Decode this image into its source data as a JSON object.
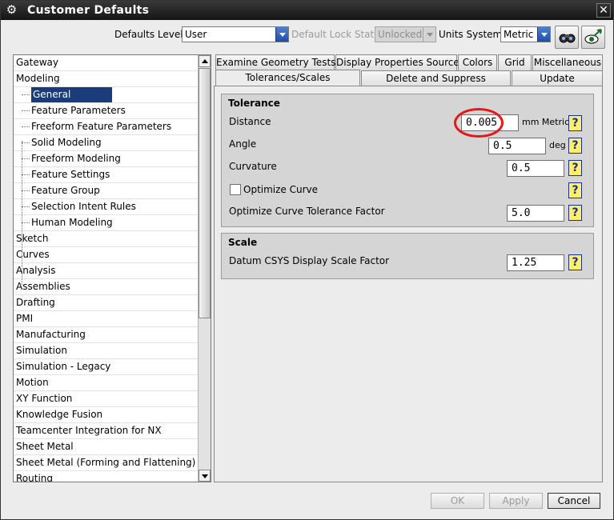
{
  "window": {
    "title": "Customer Defaults"
  },
  "toolbar": {
    "defaults_level_label": "Defaults Level",
    "defaults_level_value": "User",
    "lock_state_label": "Default Lock State",
    "lock_state_value": "Unlocked",
    "units_system_label": "Units System",
    "units_system_value": "Metric"
  },
  "tree": {
    "items": [
      {
        "label": "Gateway",
        "level": 0
      },
      {
        "label": "Modeling",
        "level": 0
      },
      {
        "label": "General",
        "level": 1,
        "selected": true
      },
      {
        "label": "Feature Parameters",
        "level": 1
      },
      {
        "label": "Freeform Feature Parameters",
        "level": 1
      },
      {
        "label": "Solid Modeling",
        "level": 1
      },
      {
        "label": "Freeform Modeling",
        "level": 1
      },
      {
        "label": "Feature Settings",
        "level": 1
      },
      {
        "label": "Feature Group",
        "level": 1
      },
      {
        "label": "Selection Intent Rules",
        "level": 1
      },
      {
        "label": "Human Modeling",
        "level": 1
      },
      {
        "label": "Sketch",
        "level": 0
      },
      {
        "label": "Curves",
        "level": 0
      },
      {
        "label": "Analysis",
        "level": 0
      },
      {
        "label": "Assemblies",
        "level": 0
      },
      {
        "label": "Drafting",
        "level": 0
      },
      {
        "label": "PMI",
        "level": 0
      },
      {
        "label": "Manufacturing",
        "level": 0
      },
      {
        "label": "Simulation",
        "level": 0
      },
      {
        "label": "Simulation - Legacy",
        "level": 0
      },
      {
        "label": "Motion",
        "level": 0
      },
      {
        "label": "XY Function",
        "level": 0
      },
      {
        "label": "Knowledge Fusion",
        "level": 0
      },
      {
        "label": "Teamcenter Integration for NX",
        "level": 0
      },
      {
        "label": "Sheet Metal",
        "level": 0
      },
      {
        "label": "Sheet Metal (Forming and Flattening)",
        "level": 0
      },
      {
        "label": "Routing",
        "level": 0
      }
    ]
  },
  "tabs": {
    "row1": [
      "Examine Geometry Tests",
      "Display Properties Source",
      "Colors",
      "Grid",
      "Miscellaneous"
    ],
    "row2": [
      "Tolerances/Scales",
      "Delete and Suppress",
      "Update"
    ],
    "active": "Tolerances/Scales"
  },
  "tolerance": {
    "header": "Tolerance",
    "distance_label": "Distance",
    "distance_value": "0.005",
    "distance_unit": "mm Metric",
    "angle_label": "Angle",
    "angle_value": "0.5",
    "angle_unit": "deg",
    "curvature_label": "Curvature",
    "curvature_value": "0.5",
    "optimize_curve_label": "Optimize Curve",
    "optimize_curve_checked": false,
    "optimize_factor_label": "Optimize Curve Tolerance Factor",
    "optimize_factor_value": "5.0"
  },
  "scale": {
    "header": "Scale",
    "datum_label": "Datum CSYS Display Scale Factor",
    "datum_value": "1.25"
  },
  "help_glyph": "?",
  "buttons": {
    "ok": "OK",
    "apply": "Apply",
    "cancel": "Cancel"
  },
  "colors": {
    "selection": "#1a3c7a",
    "highlight_circle": "#e8161a",
    "help_bg": "#ffef6a"
  }
}
